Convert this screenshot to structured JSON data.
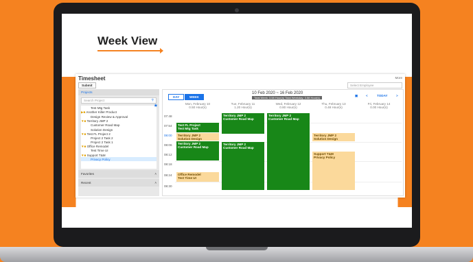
{
  "headline": "Week View",
  "app": {
    "title": "Timesheet",
    "more": "More",
    "submit": "Submit",
    "employee_placeholder": "Select Employee",
    "projects_header": "Projects",
    "search_placeholder": "Search Project",
    "tree": [
      "Test Mtg Task",
      "Another Killer Product",
      "Design Review & Approval",
      "Territory JMP 2",
      "Customer Road Map",
      "Solution Design",
      "Test FL Project 2",
      "Project 2 Task 2",
      "Project 2 Task 1",
      "Office Remodel",
      "Test Time UI",
      "Support T&M",
      "Privacy Policy"
    ],
    "favorites": "Favorites",
    "recent": "Recent",
    "tab_day": "DAY",
    "tab_week": "WEEK",
    "range": "10 Feb 2020 ~ 16 Feb 2020",
    "total": "Total Week: 3.58 Hour(s) Total Weekday: 3.58 Hour(s)",
    "today": "TODAY",
    "prev": "<",
    "next": ">",
    "days": [
      {
        "name": "Mon, February 10",
        "hours": "0.50 Hour(s)"
      },
      {
        "name": "Tue, February 11",
        "hours": "1.20 Hour(s)"
      },
      {
        "name": "Wed, February 12",
        "hours": "0.80 Hour(s)"
      },
      {
        "name": "Thu, February 13",
        "hours": "0.48 Hour(s)"
      },
      {
        "name": "Fri, February 14",
        "hours": "0.00 Hour(s)"
      }
    ],
    "times": [
      "07:48",
      "07:54",
      "08:00",
      "08:06",
      "08:12",
      "08:18",
      "08:24",
      "08:30"
    ],
    "events": [
      {
        "l1": "Test FL Project",
        "l2": "Test Mtg Task"
      },
      {
        "l1": "Territory JMP 2",
        "l2": "Solution Design"
      },
      {
        "l1": "Territory JMP 2",
        "l2": "Customer Road Map"
      },
      {
        "l1": "Office Remodel",
        "l2": "Test Time UI"
      },
      {
        "l1": "Territory JMP 2",
        "l2": "Customer Road Map"
      },
      {
        "l1": "Territory JMP 2",
        "l2": "Customer Road Map"
      },
      {
        "l1": "Territory JMP 2",
        "l2": "Customer Road Map"
      },
      {
        "l1": "Territory JMP 2",
        "l2": "Solution Design"
      },
      {
        "l1": "Support T&M",
        "l2": "Privacy Policy"
      }
    ]
  }
}
